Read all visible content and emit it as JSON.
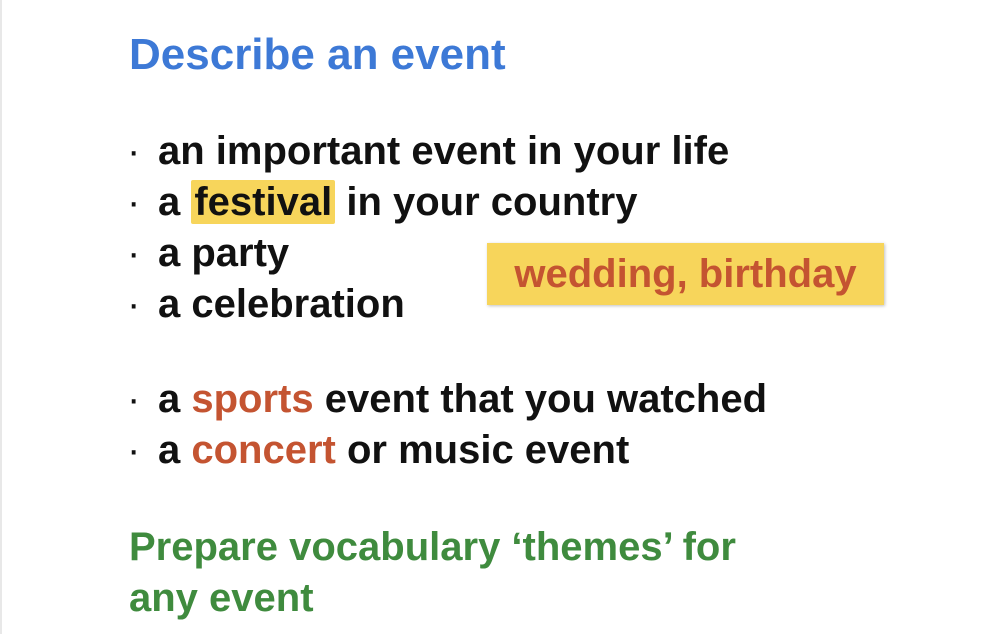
{
  "title": "Describe an event",
  "bullet_symbol": "·",
  "group1": [
    {
      "text": "an important event in your life"
    },
    {
      "prefix": "a ",
      "highlight": "festival",
      "suffix": " in your country"
    },
    {
      "text": "a party"
    },
    {
      "text": "a celebration"
    }
  ],
  "callout": "wedding, birthday",
  "group2": [
    {
      "prefix": "a ",
      "emphasis": "sports",
      "suffix": " event that you watched"
    },
    {
      "prefix": "a ",
      "emphasis": "concert",
      "suffix": " or music event"
    }
  ],
  "footer": {
    "line1": "Prepare vocabulary ‘themes’ for",
    "line2": "any event"
  },
  "colors": {
    "title": "#3d79d6",
    "footer": "#3f8b3e",
    "emphasis": "#c45431",
    "highlight": "#f7d55b"
  }
}
